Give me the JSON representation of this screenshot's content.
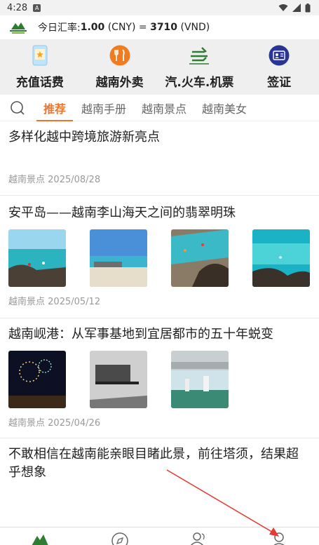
{
  "status_bar": {
    "time": "4:28",
    "notif_letter": "A"
  },
  "rate_bar": {
    "prefix": "今日汇率: ",
    "cny_amount": "1.00",
    "cny_unit": " (CNY) = ",
    "vnd_amount": "3710",
    "vnd_unit": " (VND)"
  },
  "services": [
    {
      "label": "充值话费",
      "icon": "phone-recharge-icon"
    },
    {
      "label": "越南外卖",
      "icon": "food-delivery-icon"
    },
    {
      "label": "汽.火车.机票",
      "icon": "transport-ticket-icon"
    },
    {
      "label": "签证",
      "icon": "visa-icon"
    }
  ],
  "tabs": [
    {
      "label": "推荐",
      "active": true
    },
    {
      "label": "越南手册",
      "active": false
    },
    {
      "label": "越南景点",
      "active": false
    },
    {
      "label": "越南美女",
      "active": false
    }
  ],
  "articles": [
    {
      "title": "多样化越中跨境旅游新亮点",
      "category": "越南景点",
      "date": "2025/08/28"
    },
    {
      "title": "安平岛——越南李山海天之间的翡翠明珠",
      "category": "越南景点",
      "date": "2025/05/12"
    },
    {
      "title": "越南岘港：从军事基地到宜居都市的五十年蜕变",
      "category": "越南景点",
      "date": "2025/04/26"
    },
    {
      "title": "不敢相信在越南能亲眼目睹此景，前往塔须，结果超乎想象",
      "category": "",
      "date": ""
    }
  ],
  "bottom_nav": [
    {
      "icon": "home-icon"
    },
    {
      "icon": "discover-icon"
    },
    {
      "icon": "community-icon"
    },
    {
      "icon": "profile-icon"
    }
  ],
  "colors": {
    "accent": "#f0742a",
    "brand_green": "#2e7d32",
    "arrow": "#e53935"
  }
}
